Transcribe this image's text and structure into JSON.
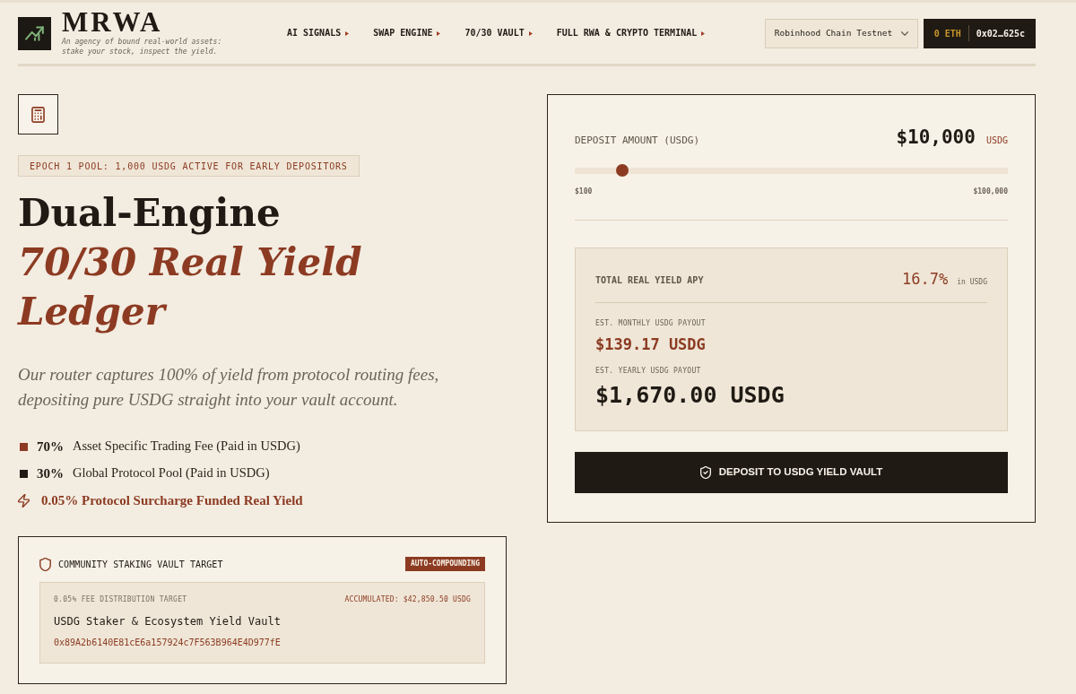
{
  "header": {
    "brand": {
      "name": "MRWA",
      "tagline": "An agency of bound real-world assets: stake your stock, inspect the yield."
    },
    "nav": [
      "AI SIGNALS",
      "SWAP ENGINE",
      "70/30 VAULT",
      "FULL RWA & CRYPTO TERMINAL"
    ],
    "network_select": {
      "value": "Robinhood Chain Testnet"
    },
    "wallet": {
      "balance": "0 ETH",
      "address": "0x02…625c"
    }
  },
  "hero": {
    "badge": "EPOCH 1 POOL: 1,000 USDG ACTIVE FOR EARLY DEPOSITORS",
    "title": "Dual-Engine",
    "title_accent": "70/30 Real Yield Ledger",
    "description": "Our router captures 100% of yield from protocol routing fees, depositing pure USDG straight into your vault account.",
    "splits": [
      {
        "share": "70%",
        "label": "Asset Specific Trading Fee (Paid in USDG)",
        "color": "#8c3b22"
      },
      {
        "share": "30%",
        "label": "Global Protocol Pool (Paid in USDG)",
        "color": "#1f1a14"
      }
    ],
    "surcharge_note": "0.05% Protocol Surcharge Funded Real Yield"
  },
  "vault_card": {
    "title": "COMMUNITY STAKING VAULT TARGET",
    "badge": "AUTO-COMPOUNDING",
    "target_label": "0.05% FEE DISTRIBUTION TARGET",
    "accumulated": "ACCUMULATED: $42,850.50 USDG",
    "name": "USDG Staker & Ecosystem Yield Vault",
    "address": "0x89A2b6140E81cE6a157924c7F563B964E4D977fE"
  },
  "calculator": {
    "deposit_label": "DEPOSIT AMOUNT (USDG)",
    "amount": "$10,000",
    "amount_unit": "USDG",
    "slider": {
      "level": 0.11,
      "min_label": "$100",
      "max_label": "$100,000"
    },
    "apy_label": "TOTAL REAL YIELD APY",
    "apy": "16.7%",
    "apy_unit": "in USDG",
    "monthly_label": "EST. MONTHLY USDG PAYOUT",
    "monthly": "$139.17 USDG",
    "yearly_label": "EST. YEARLY USDG PAYOUT",
    "yearly": "$1,670.00 USDG",
    "button": "DEPOSIT TO USDG YIELD VAULT"
  }
}
